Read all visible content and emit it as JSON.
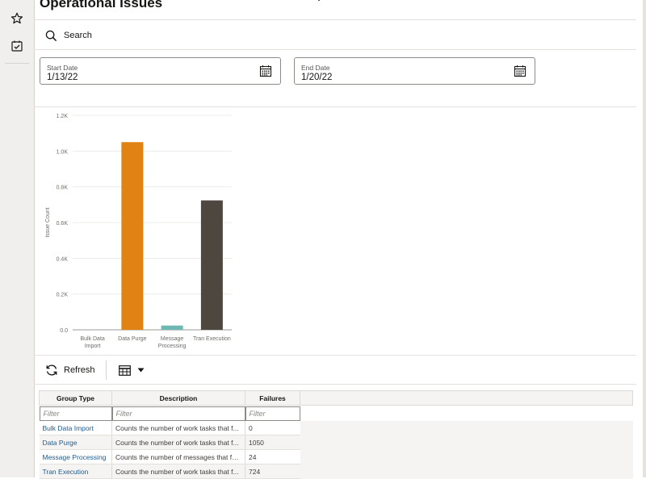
{
  "page": {
    "title": "Operational Issues"
  },
  "rail": {
    "favorites_icon": "star-icon",
    "tasks_icon": "checklist-icon"
  },
  "search": {
    "label": "Search",
    "icon": "search-icon"
  },
  "dates": {
    "start": {
      "label": "Start Date",
      "value": "1/13/22",
      "icon": "calendar-icon"
    },
    "end": {
      "label": "End Date",
      "value": "1/20/22",
      "icon": "calendar-icon"
    }
  },
  "chart_data": {
    "type": "bar",
    "ylabel": "Issue Count",
    "ylim": [
      0,
      1200
    ],
    "yticks": [
      "0.0",
      "0.2K",
      "0.4K",
      "0.6K",
      "0.8K",
      "1.0K",
      "1.2K"
    ],
    "categories": [
      [
        "Bulk Data",
        "Import"
      ],
      [
        "Data Purge"
      ],
      [
        "Message",
        "Processing"
      ],
      [
        "Tran Execution"
      ]
    ],
    "values": [
      0,
      1050,
      24,
      724
    ],
    "colors": [
      "#3a82c4",
      "#e08214",
      "#6db8b2",
      "#4e4740"
    ],
    "grid": true
  },
  "toolbar": {
    "refresh_label": "Refresh",
    "refresh_icon": "refresh-icon",
    "view_icon": "table-view-icon"
  },
  "table": {
    "headers": [
      "Group Type",
      "Description",
      "Failures"
    ],
    "filter_placeholder": "Filter",
    "rows": [
      {
        "group": "Bulk Data Import",
        "description": "Counts the number of work tasks that f...",
        "failures": "0"
      },
      {
        "group": "Data Purge",
        "description": "Counts the number of work tasks that f...",
        "failures": "1050"
      },
      {
        "group": "Message Processing",
        "description": "Counts the number of messages that fai...",
        "failures": "24"
      },
      {
        "group": "Tran Execution",
        "description": "Counts the number of work tasks that f...",
        "failures": "724"
      }
    ]
  }
}
